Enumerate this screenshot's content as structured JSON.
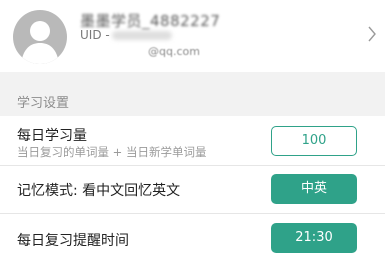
{
  "profile": {
    "name": "墨墨学员_4882227",
    "uid_label": "UID -",
    "email_suffix": "@qq.com"
  },
  "section": {
    "title": "学习设置"
  },
  "settings": [
    {
      "title": "每日学习量",
      "subtitle": "当日复习的单词量 + 当日新学单词量",
      "value": "100",
      "style": "outline"
    },
    {
      "title": "记忆模式: 看中文回忆英文",
      "value": "中英",
      "style": "filled"
    },
    {
      "title": "每日复习提醒时间",
      "value": "21:30",
      "style": "filled"
    }
  ],
  "colors": {
    "accent": "#2fa289",
    "section_bg": "#f2f2f2",
    "avatar_bg": "#b9b9b9"
  },
  "icons": {
    "avatar": "default-user-avatar-icon",
    "chevron": "chevron-right-icon"
  }
}
